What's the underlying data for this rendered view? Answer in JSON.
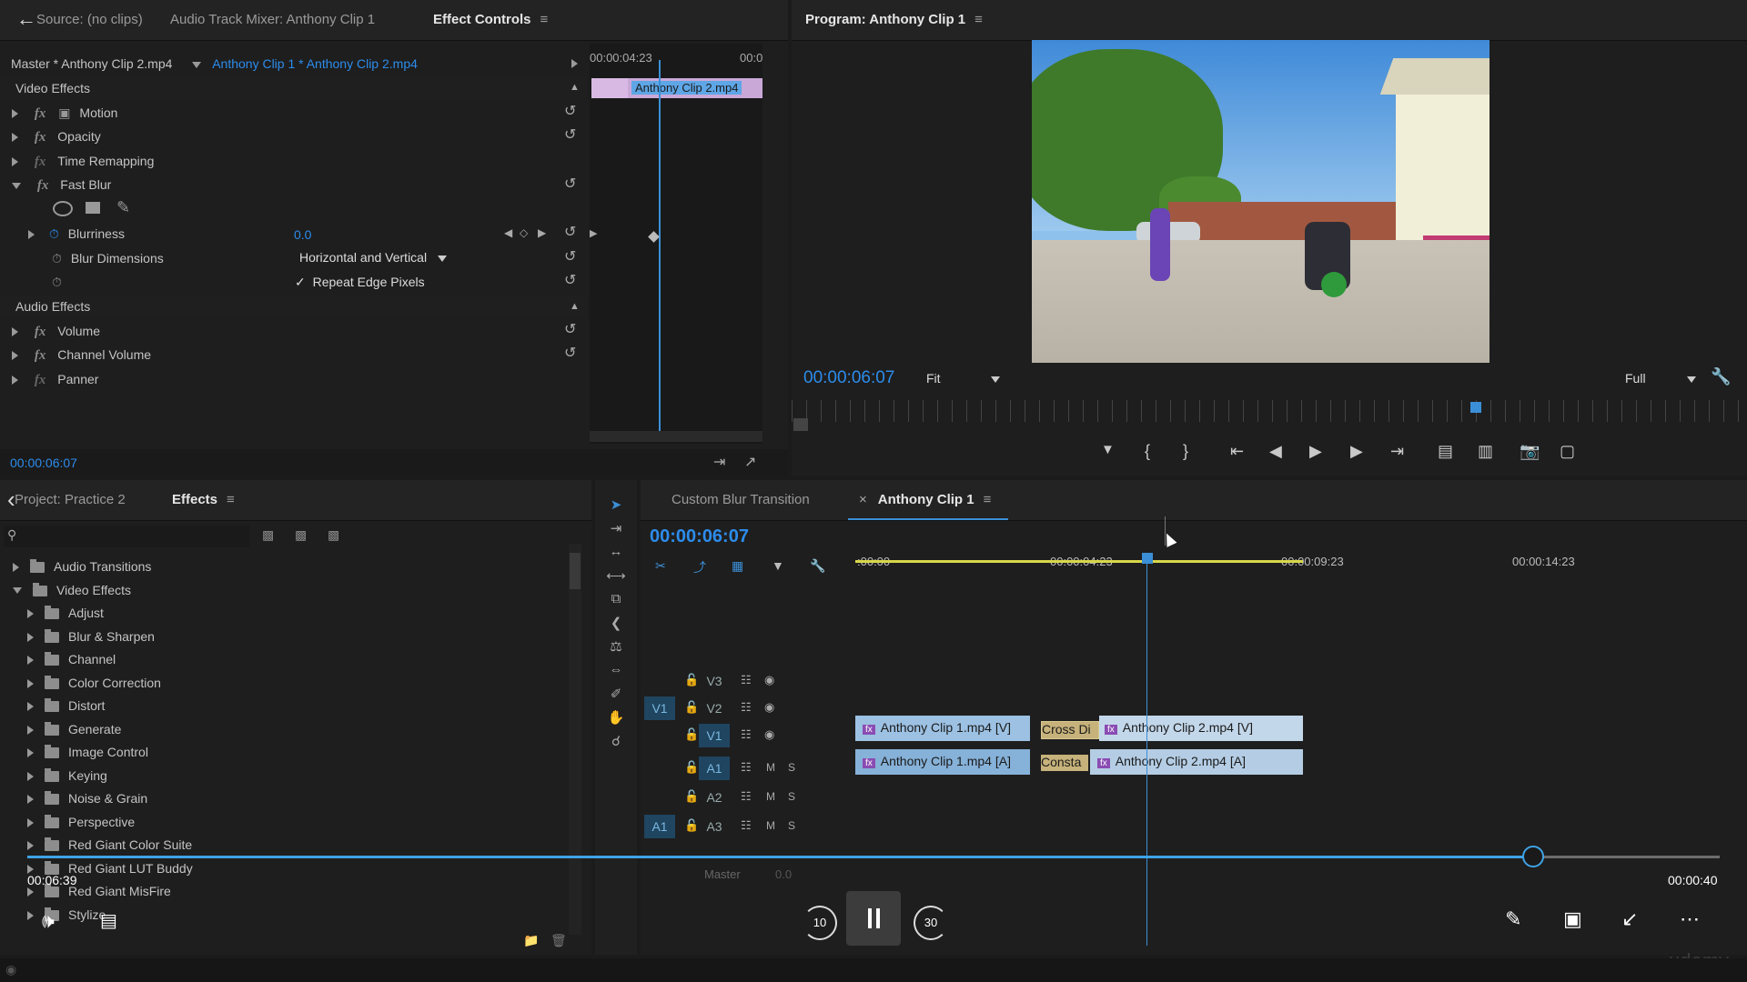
{
  "effect_controls": {
    "tabs": [
      "Source: (no clips)",
      "Audio Track Mixer: Anthony Clip 1",
      "Effect Controls"
    ],
    "master_label": "Master * Anthony Clip 2.mp4",
    "sequence_label": "Anthony Clip 1 * Anthony Clip 2.mp4",
    "timeline_time": "00:00:04:23",
    "timeline_time_end": "00:0",
    "clip_label": "Anthony Clip 2.mp4",
    "video_effects_header": "Video Effects",
    "effects": [
      "Motion",
      "Opacity",
      "Time Remapping",
      "Fast Blur"
    ],
    "blurriness_label": "Blurriness",
    "blurriness_value": "0.0",
    "blur_dimensions_label": "Blur Dimensions",
    "blur_dimensions_value": "Horizontal and Vertical",
    "repeat_edge_label": "Repeat Edge Pixels",
    "audio_effects_header": "Audio Effects",
    "audio_effects": [
      "Volume",
      "Channel Volume",
      "Panner"
    ],
    "current_time": "00:00:06:07"
  },
  "program": {
    "title": "Program: Anthony Clip 1",
    "timecode": "00:00:06:07",
    "fit": "Fit",
    "quality": "Full"
  },
  "project": {
    "tabs": [
      "Project: Practice 2",
      "Effects"
    ],
    "folders": [
      {
        "label": "Audio Transitions",
        "level": 0,
        "open": false
      },
      {
        "label": "Video Effects",
        "level": 0,
        "open": true
      },
      {
        "label": "Adjust",
        "level": 1,
        "open": false
      },
      {
        "label": "Blur & Sharpen",
        "level": 1,
        "open": false
      },
      {
        "label": "Channel",
        "level": 1,
        "open": false
      },
      {
        "label": "Color Correction",
        "level": 1,
        "open": false
      },
      {
        "label": "Distort",
        "level": 1,
        "open": false
      },
      {
        "label": "Generate",
        "level": 1,
        "open": false
      },
      {
        "label": "Image Control",
        "level": 1,
        "open": false
      },
      {
        "label": "Keying",
        "level": 1,
        "open": false
      },
      {
        "label": "Noise & Grain",
        "level": 1,
        "open": false
      },
      {
        "label": "Perspective",
        "level": 1,
        "open": false
      },
      {
        "label": "Red Giant Color Suite",
        "level": 1,
        "open": false
      },
      {
        "label": "Red Giant LUT Buddy",
        "level": 1,
        "open": false
      },
      {
        "label": "Red Giant MisFire",
        "level": 1,
        "open": false
      },
      {
        "label": "Stylize",
        "level": 1,
        "open": false
      }
    ]
  },
  "timeline": {
    "tabs": [
      "Custom Blur Transition",
      "Anthony Clip 1"
    ],
    "timecode": "00:00:06:07",
    "ruler": ":00:00",
    "ruler2": "00:00:04:23",
    "ruler3": "00:00:09:23",
    "ruler4": "00:00:14:23",
    "tracks": [
      "V3",
      "V2",
      "V1",
      "A1",
      "A2",
      "A3"
    ],
    "source_v": "V1",
    "source_a": "A1",
    "master_label": "Master",
    "master_value": "0.0",
    "clips": {
      "v1_a": "Anthony Clip 1.mp4 [V]",
      "v1_trans": "Cross Di",
      "v1_b": "Anthony Clip 2.mp4 [V]",
      "a1_a": "Anthony Clip 1.mp4 [A]",
      "a1_trans": "Consta",
      "a1_b": "Anthony Clip 2.mp4 [A]"
    },
    "m": "M",
    "s": "S"
  },
  "player": {
    "elapsed": "00:06:39",
    "duration": "00:00:40",
    "rewind": "10",
    "forward": "30",
    "progress": 0.89,
    "watermark": "udemy"
  }
}
